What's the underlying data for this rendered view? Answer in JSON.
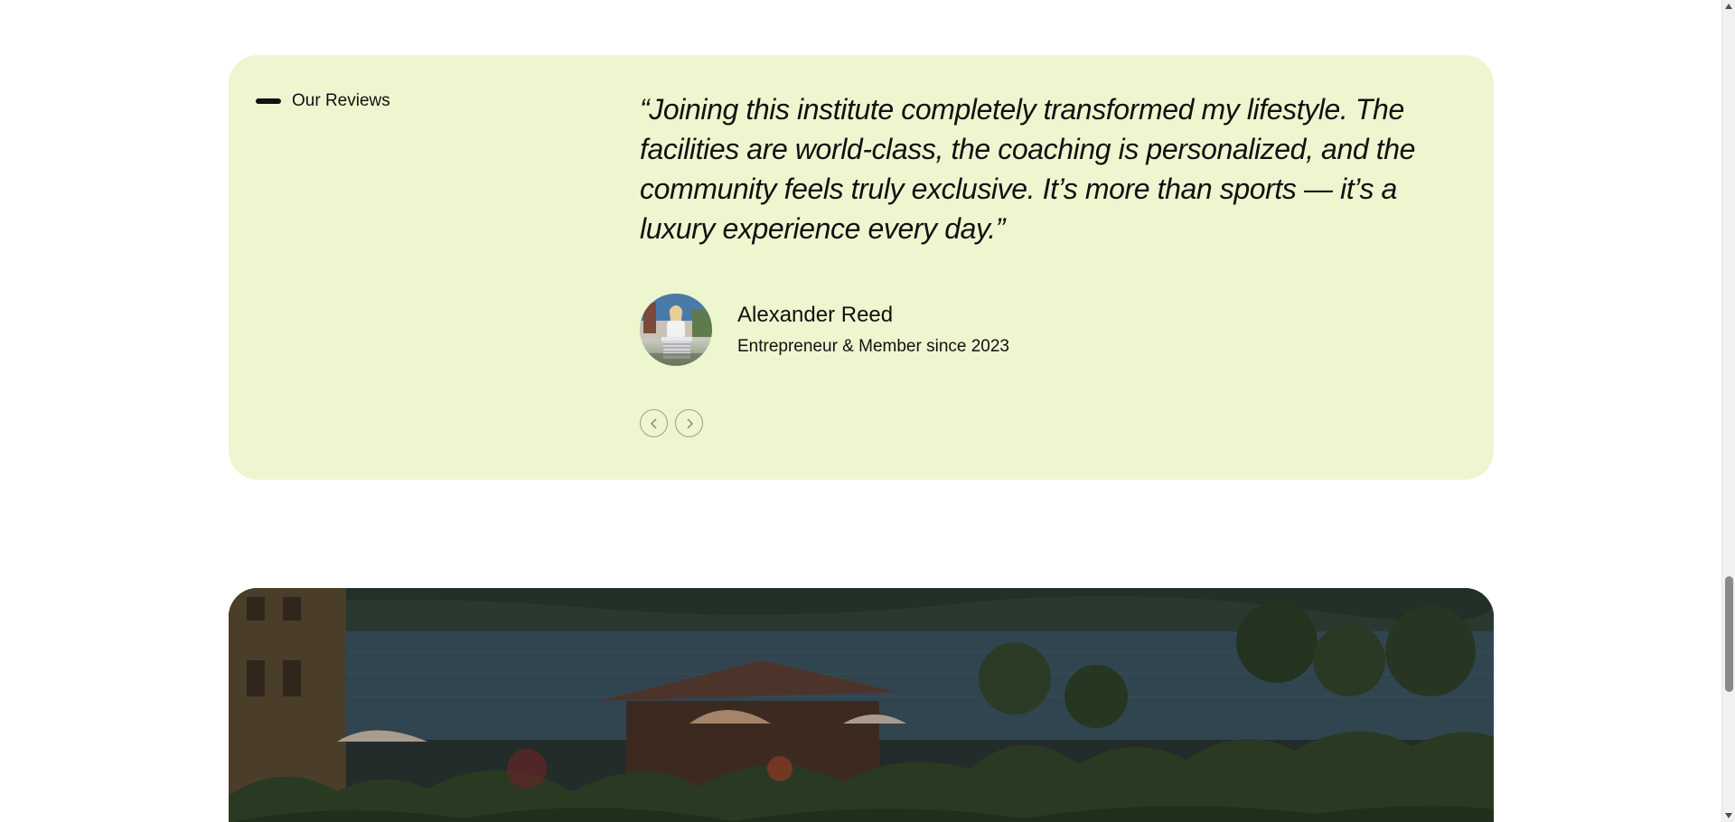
{
  "reviews": {
    "section_label": "Our Reviews",
    "quote": "“Joining this institute completely transformed my lifestyle. The facilities are world-class, the coaching is personalized, and the community feels truly exclusive. It’s more than sports — it’s a luxury experience every day.”",
    "author": {
      "name": "Alexander Reed",
      "role": "Entrepreneur & Member since 2023"
    },
    "nav": {
      "prev_icon": "chevron-left-icon",
      "next_icon": "chevron-right-icon"
    }
  },
  "colors": {
    "card_background": "#eef6cf",
    "text": "#111111",
    "page_background": "#ffffff"
  }
}
